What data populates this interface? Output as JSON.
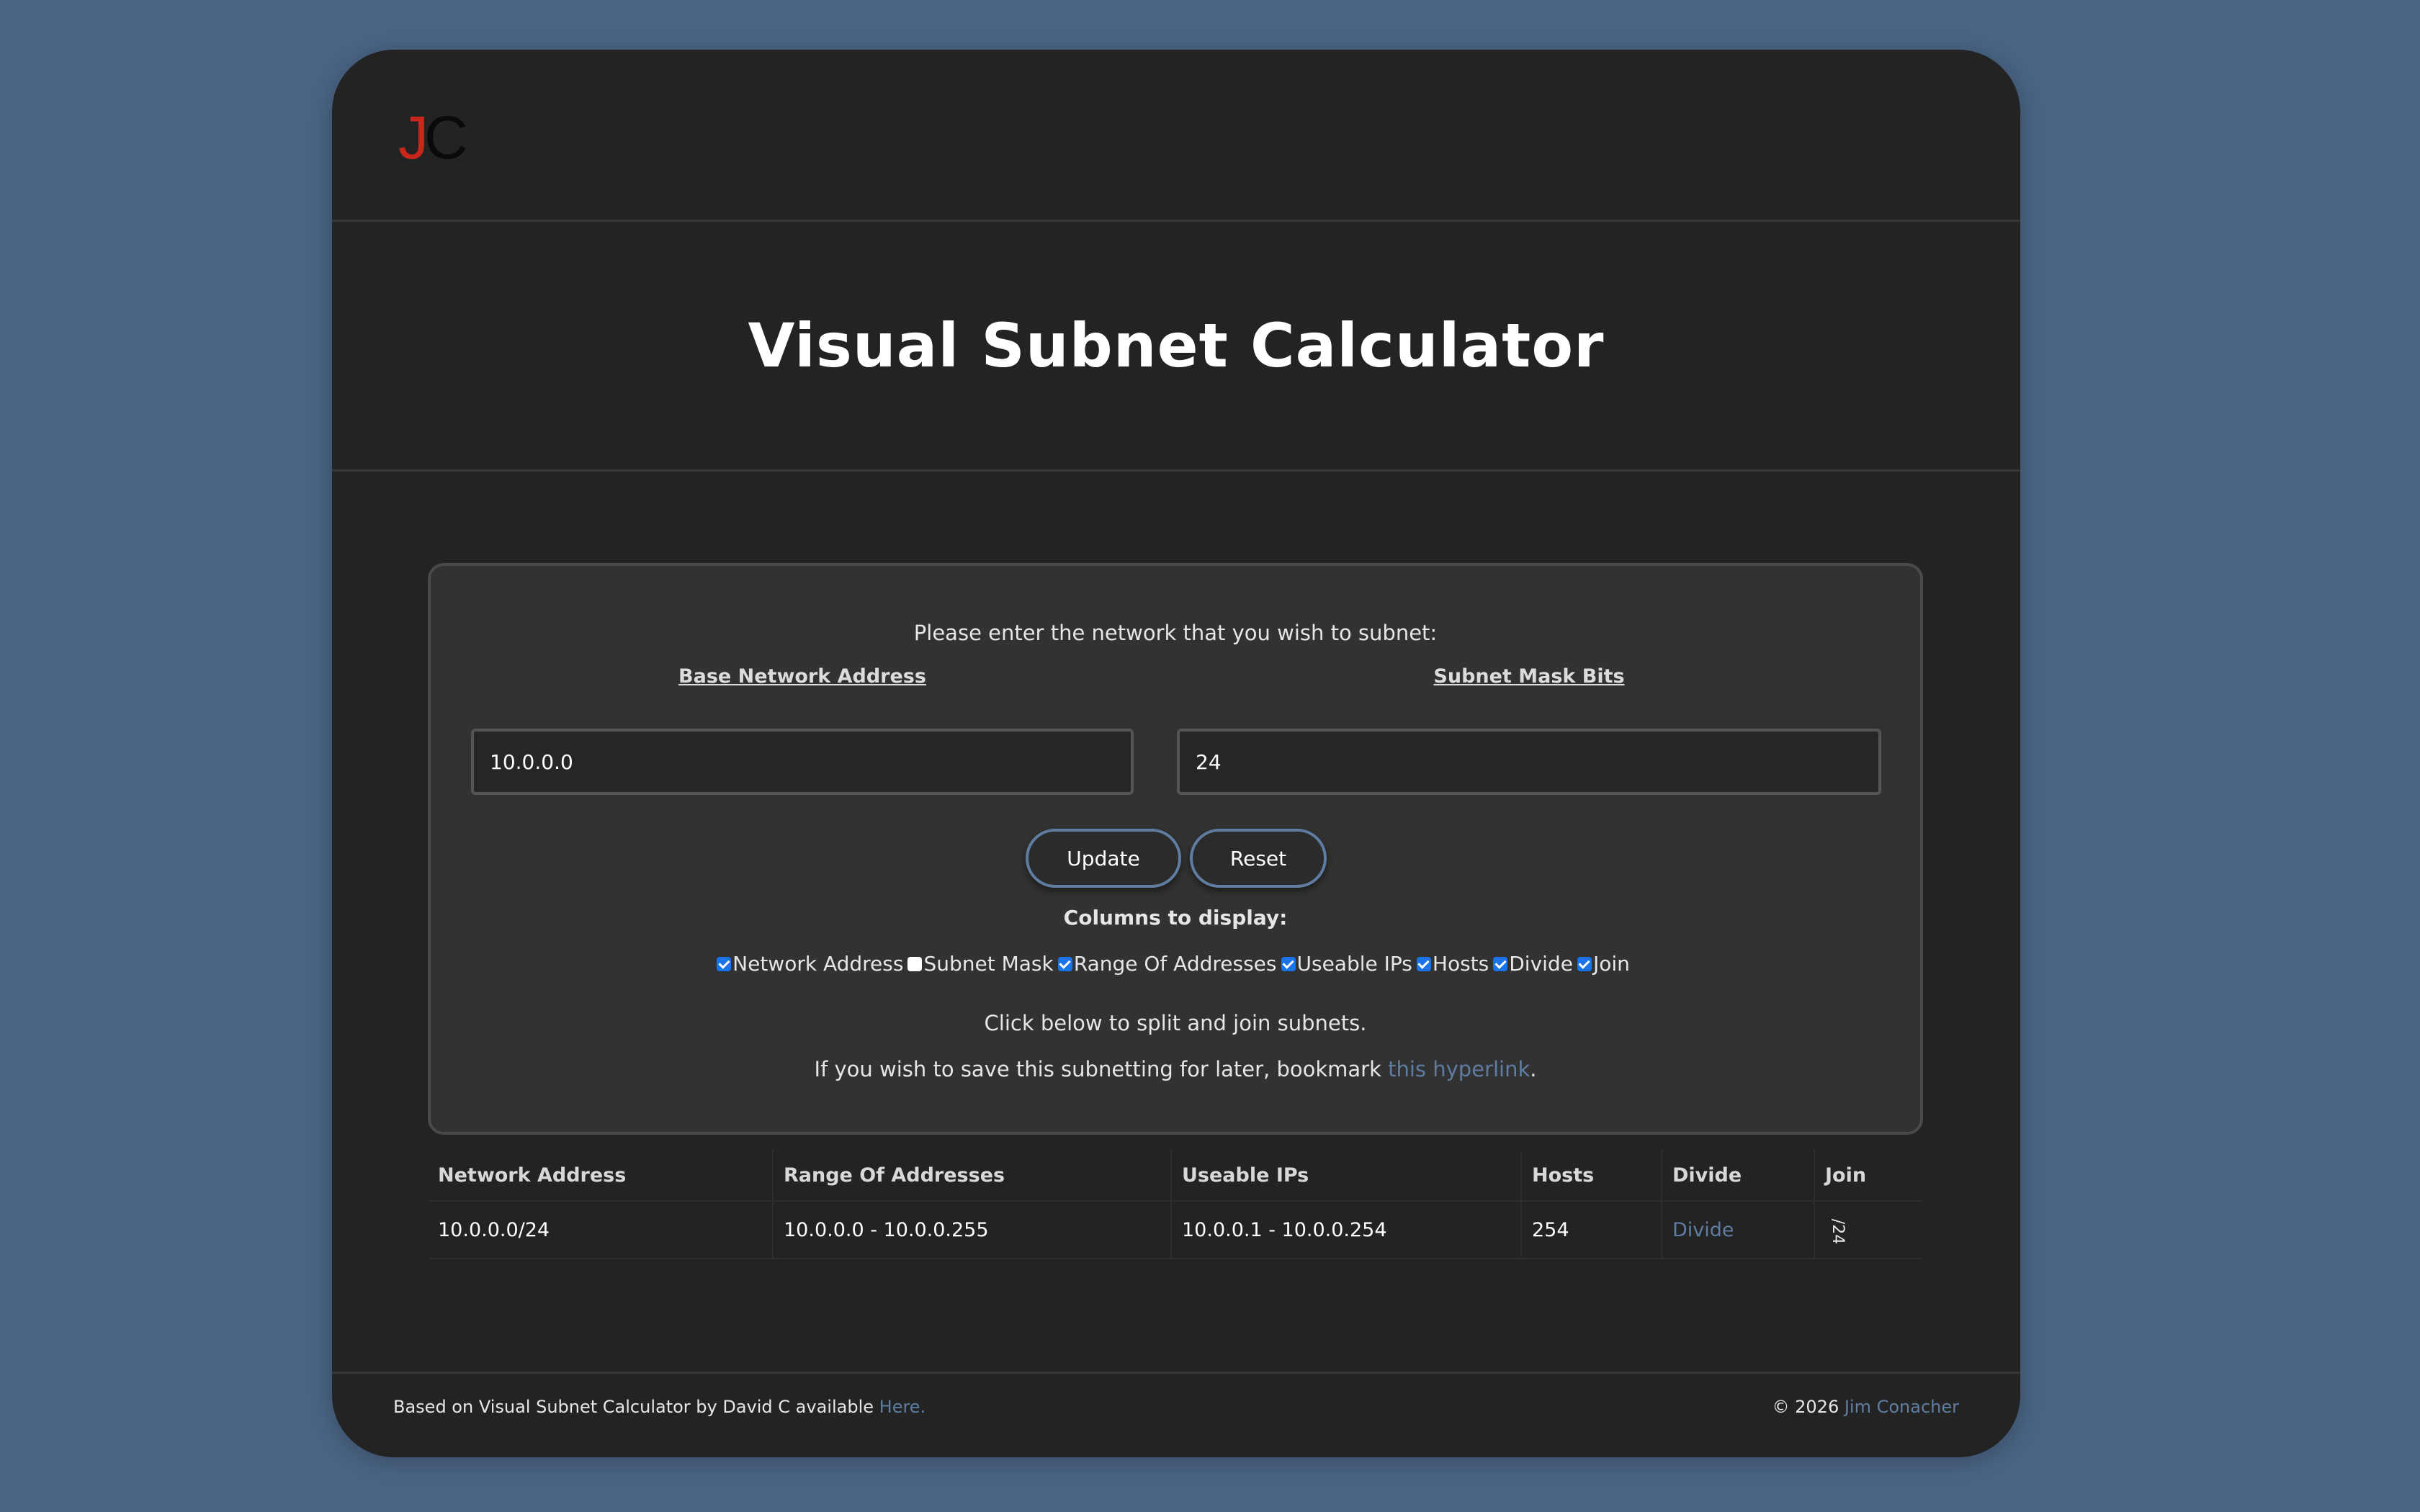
{
  "logo": {
    "letter1": "J",
    "letter2": "C"
  },
  "page": {
    "title": "Visual Subnet Calculator"
  },
  "form": {
    "prompt": "Please enter the network that you wish to subnet:",
    "base_label": "Base Network Address",
    "mask_label": "Subnet Mask Bits",
    "base_value": "10.0.0.0",
    "mask_value": "24",
    "update_label": "Update",
    "reset_label": "Reset",
    "columns_title": "Columns to display:",
    "columns": [
      {
        "label": "Network Address",
        "checked": true
      },
      {
        "label": "Subnet Mask",
        "checked": false
      },
      {
        "label": "Range Of Addresses",
        "checked": true
      },
      {
        "label": "Useable IPs",
        "checked": true
      },
      {
        "label": "Hosts",
        "checked": true
      },
      {
        "label": "Divide",
        "checked": true
      },
      {
        "label": "Join",
        "checked": true
      }
    ],
    "split_hint": "Click below to split and join subnets.",
    "save_prefix": "If you wish to save this subnetting for later, bookmark ",
    "save_link": "this hyperlink",
    "save_suffix": "."
  },
  "table": {
    "headers": [
      "Network Address",
      "Range Of Addresses",
      "Useable IPs",
      "Hosts",
      "Divide",
      "Join"
    ],
    "rows": [
      {
        "network": "10.0.0.0/24",
        "range": "10.0.0.0 - 10.0.0.255",
        "useable": "10.0.0.1 - 10.0.0.254",
        "hosts": "254",
        "divide": "Divide",
        "join": "/24"
      }
    ]
  },
  "footer": {
    "left_text": "Based on Visual Subnet Calculator by David C available ",
    "left_link": "Here.",
    "right_text": "© 2026 ",
    "right_link": "Jim Conacher"
  },
  "colors": {
    "background": "#4a6585",
    "card": "#232323",
    "panel": "#323232",
    "accent": "#5f7da1",
    "logo_j": "#c9271b",
    "checkbox_on": "#1a73e8"
  }
}
